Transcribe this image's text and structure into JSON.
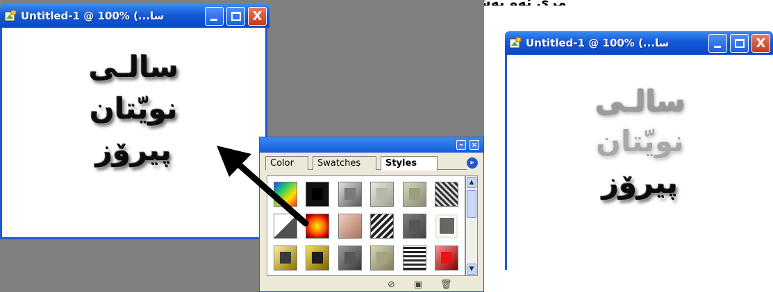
{
  "top_text": "مری ئەو بەشەی شایەنی ئەوەیە کە ستایلەکە",
  "left_window": {
    "title": "Untitled-1 @ 100% (...سا",
    "art_lines": [
      "سالـى",
      "نويّتان",
      "پيرۆز"
    ]
  },
  "right_window": {
    "title": "Untitled-1 @ 100% (...سا",
    "art_lines": [
      "سالـى",
      "نويّتان",
      "پيرۆز"
    ]
  },
  "window_buttons": {
    "minimize_icon": "minimize-icon",
    "maximize_icon": "maximize-icon",
    "close_label": "X"
  },
  "palette": {
    "tabs": [
      "Color",
      "Swatches",
      "Styles"
    ],
    "active_tab": "Styles",
    "styles": [
      "rainbow",
      "black",
      "bevel",
      "paper",
      "pewter",
      "marble",
      "triangle",
      "fire",
      "copper",
      "cracked",
      "dark",
      "outline",
      "gold",
      "gold-frame",
      "steel",
      "khaki",
      "zebra",
      "red"
    ],
    "bottom_icons": [
      "clear-style-icon",
      "new-style-icon",
      "trash-icon"
    ]
  },
  "colors": {
    "titlebar": "#1559d8",
    "close_button": "#c7391a",
    "workspace_gray": "#808080"
  }
}
